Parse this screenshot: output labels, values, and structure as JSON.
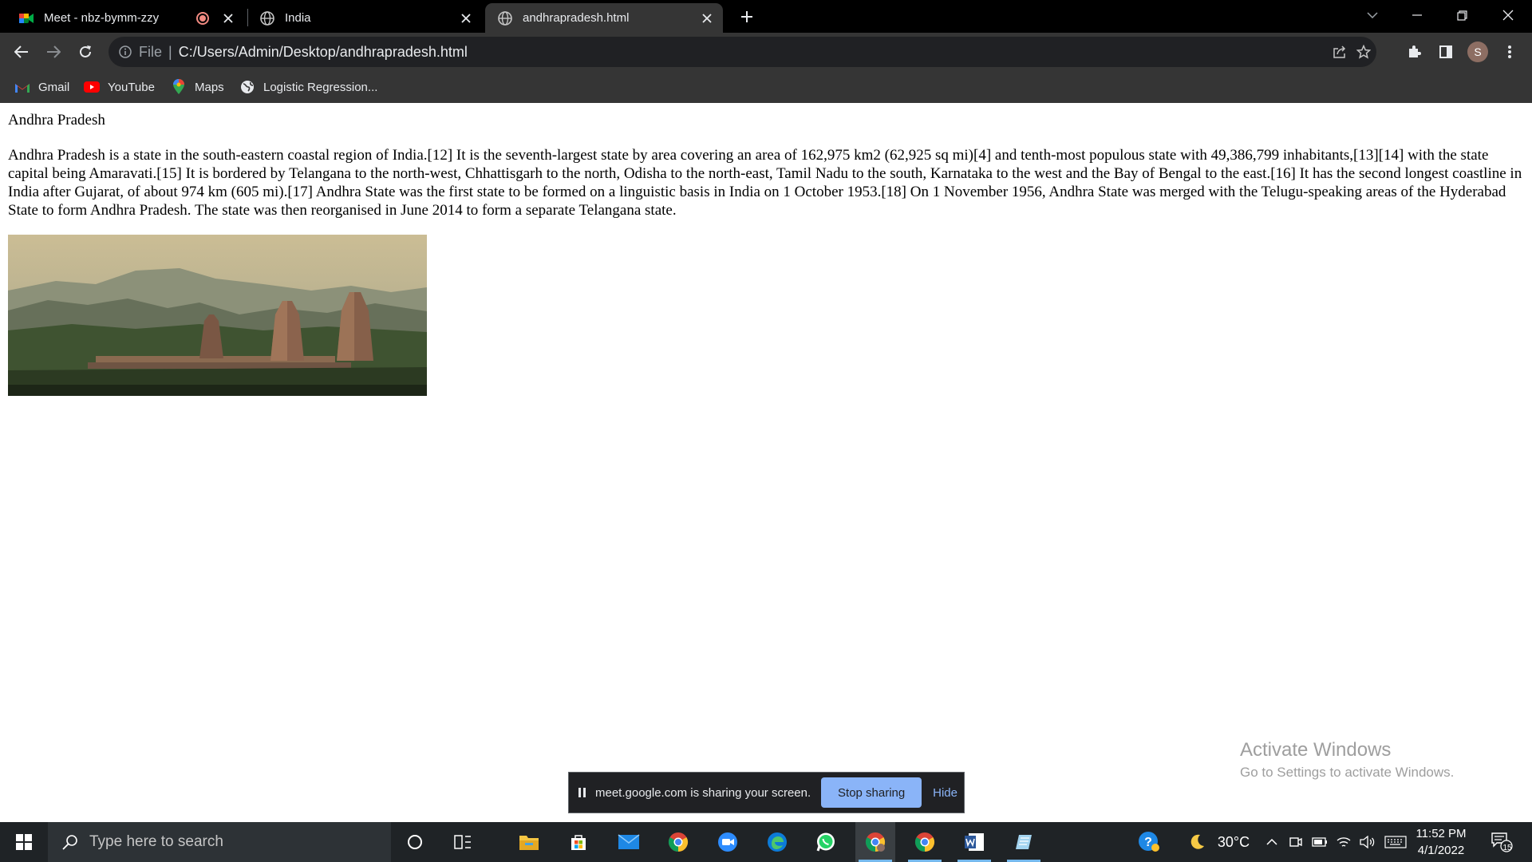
{
  "tabs": [
    {
      "title": "Meet - nbz-bymm-zzy",
      "icon": "google-meet-icon"
    },
    {
      "title": "India",
      "icon": "globe-icon"
    },
    {
      "title": "andhrapradesh.html",
      "icon": "globe-icon"
    }
  ],
  "address_bar": {
    "scheme": "File",
    "url": "C:/Users/Admin/Desktop/andhrapradesh.html"
  },
  "profile_initial": "S",
  "bookmarks": [
    {
      "label": "Gmail",
      "icon": "gmail-icon"
    },
    {
      "label": "YouTube",
      "icon": "youtube-icon"
    },
    {
      "label": "Maps",
      "icon": "maps-icon"
    },
    {
      "label": "Logistic Regression...",
      "icon": "globe-icon"
    }
  ],
  "page": {
    "heading": "Andhra Pradesh",
    "paragraph": "Andhra Pradesh is a state in the south-eastern coastal region of India.[12] It is the seventh-largest state by area covering an area of 162,975 km2 (62,925 sq mi)[4] and tenth-most populous state with 49,386,799 inhabitants,[13][14] with the state capital being Amaravati.[15] It is bordered by Telangana to the north-west, Chhattisgarh to the north, Odisha to the north-east, Tamil Nadu to the south, Karnataka to the west and the Bay of Bengal to the east.[16] It has the second longest coastline in India after Gujarat, of about 974 km (605 mi).[17] Andhra State was the first state to be formed on a linguistic basis in India on 1 October 1953.[18] On 1 November 1956, Andhra State was merged with the Telugu-speaking areas of the Hyderabad State to form Andhra Pradesh. The state was then reorganised in June 2014 to form a separate Telangana state.",
    "image": "temple-landscape-photo"
  },
  "screen_share": {
    "message": "meet.google.com is sharing your screen.",
    "stop_label": "Stop sharing",
    "hide_label": "Hide"
  },
  "watermark": {
    "title": "Activate Windows",
    "subtitle": "Go to Settings to activate Windows."
  },
  "taskbar": {
    "search_placeholder": "Type here to search",
    "apps": [
      "cortana-icon",
      "task-view-icon",
      "file-explorer-icon",
      "microsoft-store-icon",
      "mail-icon",
      "chrome-icon",
      "zoom-icon",
      "edge-icon",
      "whatsapp-icon",
      "chrome-profile-icon",
      "chrome-icon",
      "word-icon",
      "notepad-icon"
    ],
    "temperature": "30°C",
    "time": "11:52 PM",
    "date": "4/1/2022",
    "notification_count": "15"
  },
  "colors": {
    "tab_strip": "#000000",
    "toolbar": "#353535",
    "omnibox": "#202124",
    "accent_blue": "#8ab4f8",
    "taskbar": "#1f2326"
  }
}
